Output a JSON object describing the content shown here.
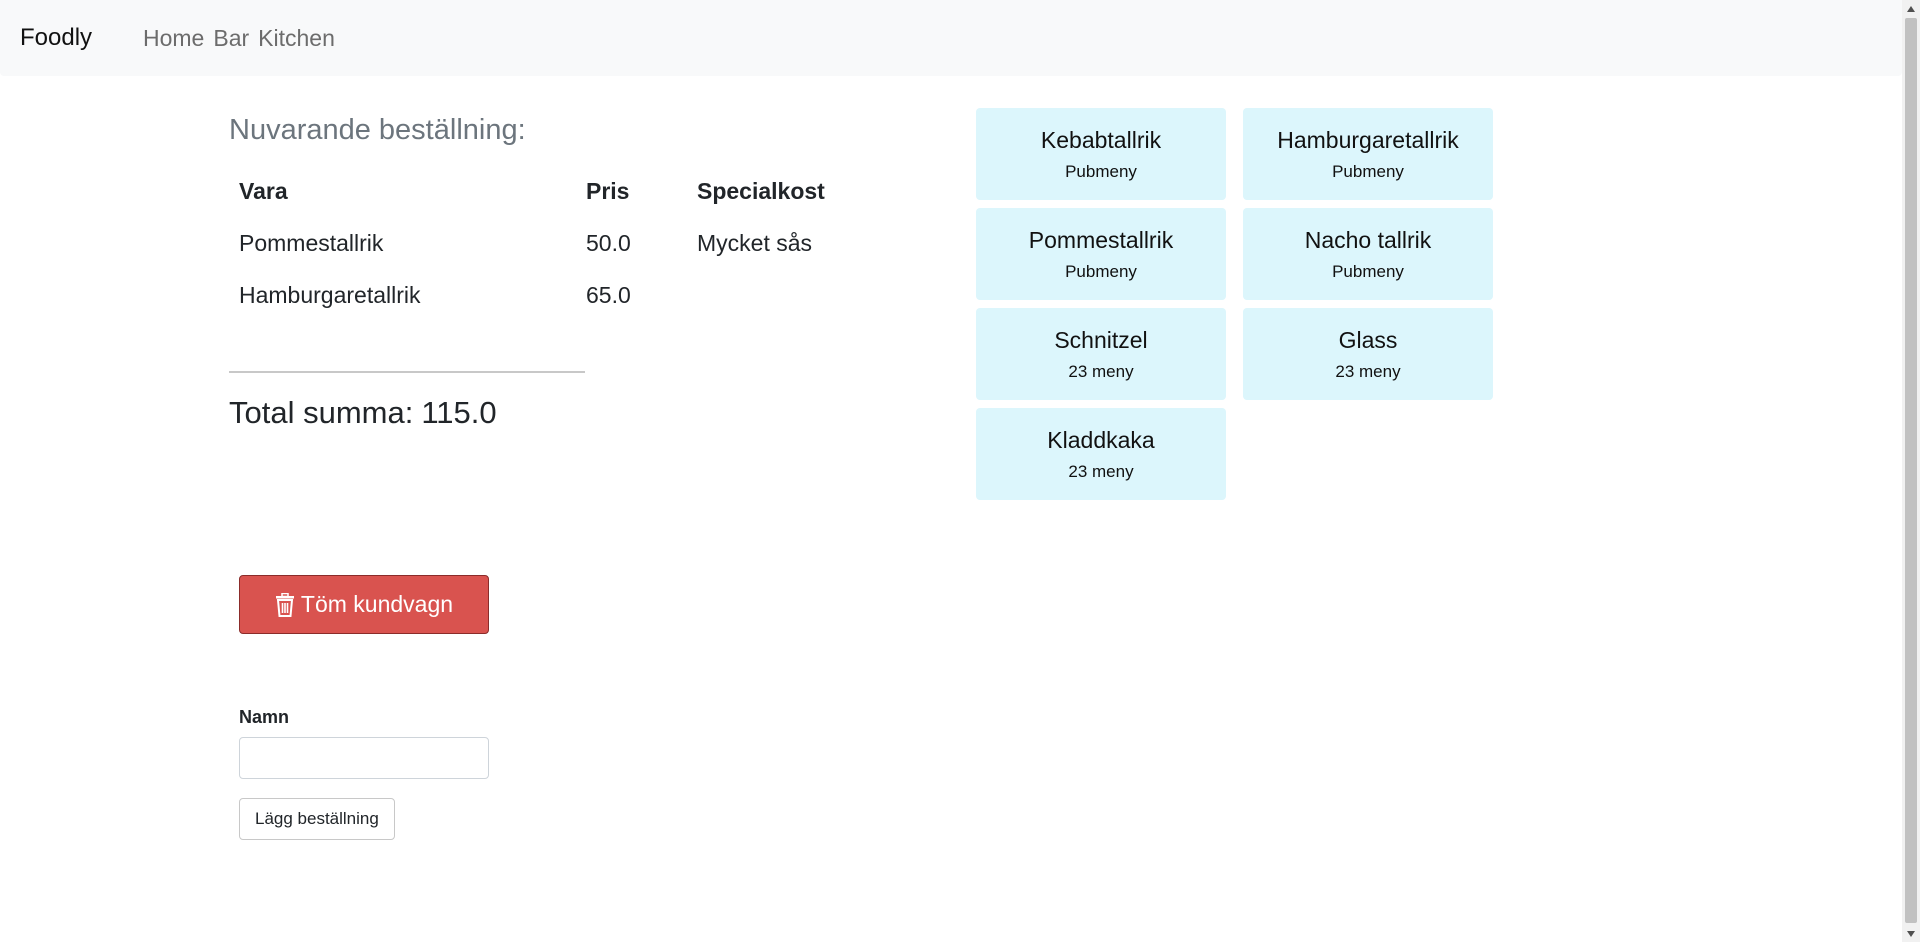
{
  "navbar": {
    "brand": "Foodly",
    "links": [
      {
        "label": "Home"
      },
      {
        "label": "Bar"
      },
      {
        "label": "Kitchen"
      }
    ]
  },
  "order": {
    "heading": "Nuvarande beställning:",
    "columns": [
      "Vara",
      "Pris",
      "Specialkost"
    ],
    "rows": [
      {
        "item": "Pommestallrik",
        "price": "50.0",
        "special": "Mycket sås"
      },
      {
        "item": "Hamburgaretallrik",
        "price": "65.0",
        "special": ""
      }
    ],
    "total_label": "Total summa:",
    "total_value": "115.0"
  },
  "actions": {
    "clear_cart_label": "Töm kundvagn",
    "clear_cart_color": "#d9534f",
    "name_label": "Namn",
    "name_value": "",
    "place_order_label": "Lägg beställning"
  },
  "menu": {
    "card_color": "#dcf6fc",
    "items": [
      {
        "name": "Kebabtallrik",
        "category": "Pubmeny"
      },
      {
        "name": "Hamburgaretallrik",
        "category": "Pubmeny"
      },
      {
        "name": "Pommestallrik",
        "category": "Pubmeny"
      },
      {
        "name": "Nacho tallrik",
        "category": "Pubmeny"
      },
      {
        "name": "Schnitzel",
        "category": "23 meny"
      },
      {
        "name": "Glass",
        "category": "23 meny"
      },
      {
        "name": "Kladdkaka",
        "category": "23 meny"
      }
    ]
  },
  "icons": {
    "clear_cart": "trash-icon"
  }
}
